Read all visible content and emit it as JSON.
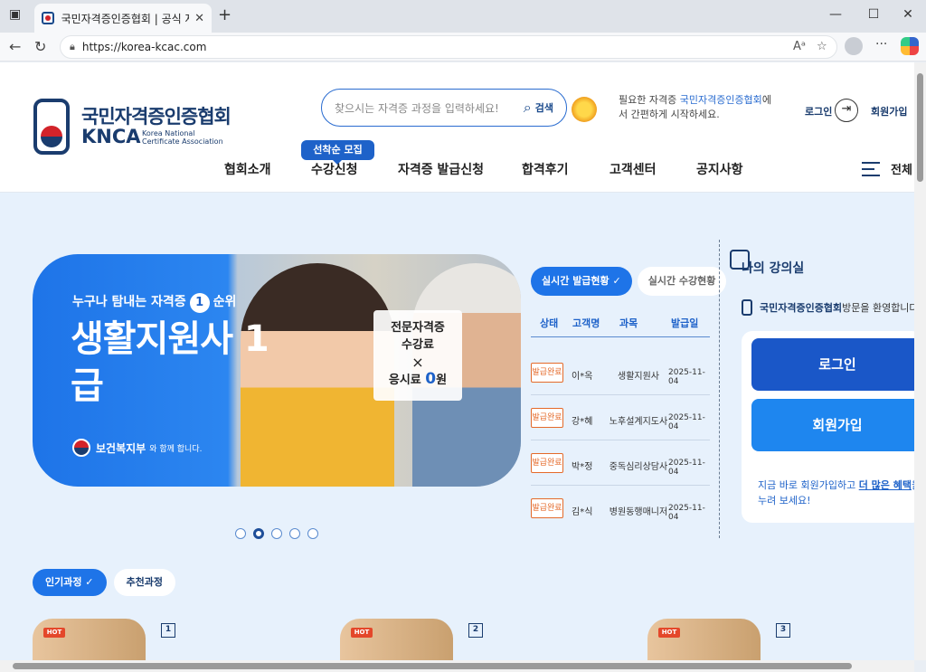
{
  "browser": {
    "tab_title": "국민자격증인증협회 | 공식 자격증",
    "tab_close": "✕",
    "new_tab": "+",
    "url": "https://korea-kcac.com",
    "window_controls": [
      "—",
      "☐",
      "✕"
    ]
  },
  "header": {
    "logo_ko": "국민자격증인증협회",
    "logo_en": "KNCA",
    "logo_sub": "Korea National Certificate Association",
    "search_placeholder": "찾으시는 자격증 과정을 입력하세요!",
    "search_label": "검색",
    "promo_prefix": "필요한 자격증 ",
    "promo_brand": "국민자격증인증협회",
    "promo_suffix": "에서 간편하게 시작하세요.",
    "login": "로그인",
    "join": "회원가입",
    "nav_badge": "선착순 모집",
    "nav": [
      "협회소개",
      "수강신청",
      "자격증 발급신청",
      "합격후기",
      "고객센터",
      "공지사항"
    ],
    "menu_all": "전체"
  },
  "hero": {
    "eyebrow_pre": "누구나 탐내는 자격증",
    "eyebrow_num": "1",
    "eyebrow_post": "순위",
    "title": "생활지원사 1급",
    "sponsor": "보건복지부",
    "sponsor_suffix": "와 함께 합니다.",
    "card_line1": "전문자격증",
    "card_line2": "수강료",
    "card_x": "×",
    "card_line3_pre": "응시료 ",
    "card_zero": "0",
    "card_line3_post": "원",
    "slides": 5,
    "active_slide": 2
  },
  "realtime": {
    "tab_active": "실시간 발급현황 ✓",
    "tab_inactive": "실시간 수강현황",
    "columns": [
      "상태",
      "고객명",
      "과목",
      "발급일"
    ],
    "rows": [
      {
        "status": "발급완료",
        "name": "이*옥",
        "course": "생활지원사",
        "date": "2025-11-04"
      },
      {
        "status": "발급완료",
        "name": "강*혜",
        "course": "노후설계지도사",
        "date": "2025-11-04"
      },
      {
        "status": "발급완료",
        "name": "박*정",
        "course": "중독심리상담사",
        "date": "2025-11-04"
      },
      {
        "status": "발급완료",
        "name": "김*식",
        "course": "병원동행매니저",
        "date": "2025-11-04"
      }
    ]
  },
  "myclass": {
    "title": "나의 강의실",
    "welcome_brand": "국민자격증인증협회",
    "welcome_suffix": " 방문을 환영합니다",
    "login_btn": "로그인",
    "join_btn": "회원가입",
    "note_pre": "지금 바로 회원가입하고 ",
    "note_em": "더 많은 혜택",
    "note_post": "을",
    "note_line2": "누려 보세요!"
  },
  "courses": {
    "tab_active": "인기과정 ✓",
    "tab_inactive": "추천과정",
    "hot": "HOT",
    "ranks": [
      "1",
      "2",
      "3"
    ]
  }
}
